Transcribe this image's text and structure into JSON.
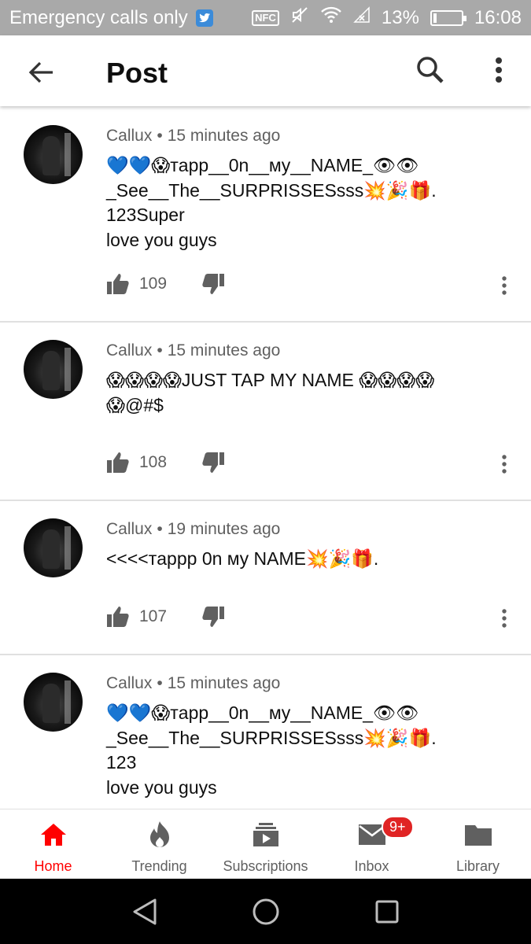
{
  "status_bar": {
    "carrier_text": "Emergency calls only",
    "nfc_label": "NFC",
    "battery_percent_text": "13%",
    "battery_level": 0.13,
    "time": "16:08"
  },
  "app_bar": {
    "title": "Post",
    "back_icon": "arrow-back-icon",
    "search_icon": "search-icon",
    "more_icon": "more-vert-icon"
  },
  "comments": [
    {
      "author": "Callux",
      "time_ago": "15 minutes ago",
      "text": "💙💙😱тapp__0n__мy__NAME_👁👁\n_See__The__SURPRISSESsss💥🎉🎁.\n123Super\nlove you guys",
      "likes": "109"
    },
    {
      "author": "Callux",
      "time_ago": "15 minutes ago",
      "text": "😱😱😱😱JUST TAP MY NAME 😱😱😱😱\n😱@#$",
      "likes": "108"
    },
    {
      "author": "Callux",
      "time_ago": "19 minutes ago",
      "text": "<<<<тappp 0n мy NAME💥🎉🎁.",
      "likes": "107"
    },
    {
      "author": "Callux",
      "time_ago": "15 minutes ago",
      "text": "💙💙😱тapp__0n__мy__NAME_👁👁\n_See__The__SURPRISSESsss💥🎉🎁.\n123\nlove you guys",
      "likes": ""
    }
  ],
  "bottom_nav": {
    "items": [
      {
        "label": "Home",
        "icon": "home-icon",
        "active": true
      },
      {
        "label": "Trending",
        "icon": "fire-icon",
        "active": false
      },
      {
        "label": "Subscriptions",
        "icon": "subscriptions-icon",
        "active": false
      },
      {
        "label": "Inbox",
        "icon": "mail-icon",
        "active": false,
        "badge": "9+"
      },
      {
        "label": "Library",
        "icon": "folder-icon",
        "active": false
      }
    ]
  },
  "colors": {
    "accent": "#ff0000",
    "badge": "#e02424",
    "status_bar": "#a9a9a9",
    "secondary_text": "#606060"
  }
}
